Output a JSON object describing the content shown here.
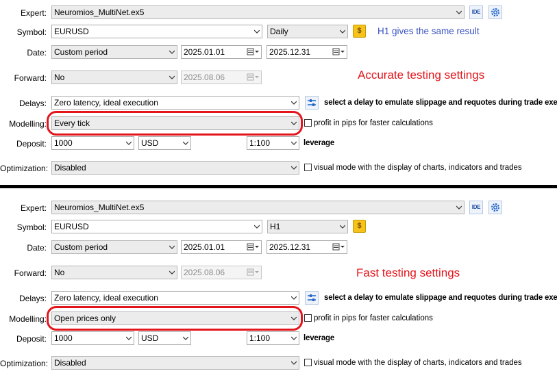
{
  "colors": {
    "accent_red": "#e3141b",
    "note_blue": "#3a52c4",
    "note_red": "#e3141b"
  },
  "labels": {
    "expert": "Expert:",
    "symbol": "Symbol:",
    "date": "Date:",
    "forward": "Forward:",
    "delays": "Delays:",
    "modelling": "Modelling:",
    "deposit": "Deposit:",
    "optimization": "Optimization:",
    "ide": "IDE",
    "coin": "$"
  },
  "hints": {
    "delay": "select a delay to emulate slippage and requotes during trade execution",
    "profit_pips": "profit in pips for faster calculations",
    "leverage": "leverage",
    "visual_mode": "visual mode with the display of charts, indicators and trades"
  },
  "top": {
    "expert": "Neuromios_MultiNet.ex5",
    "symbol": "EURUSD",
    "timeframe": "Daily",
    "date_mode": "Custom period",
    "date_from": "2025.01.01",
    "date_to": "2025.12.31",
    "forward": "No",
    "forward_date": "2025.08.06",
    "delays": "Zero latency, ideal execution",
    "modelling": "Every tick",
    "deposit": "1000",
    "currency": "USD",
    "leverage_value": "1:100",
    "optimization": "Disabled",
    "profit_pips_checked": false,
    "visual_mode_checked": false,
    "note_timeframe": "H1 gives the same result",
    "note_settings": "Accurate testing settings"
  },
  "bottom": {
    "expert": "Neuromios_MultiNet.ex5",
    "symbol": "EURUSD",
    "timeframe": "H1",
    "date_mode": "Custom period",
    "date_from": "2025.01.01",
    "date_to": "2025.12.31",
    "forward": "No",
    "forward_date": "2025.08.06",
    "delays": "Zero latency, ideal execution",
    "modelling": "Open prices only",
    "deposit": "1000",
    "currency": "USD",
    "leverage_value": "1:100",
    "optimization": "Disabled",
    "profit_pips_checked": false,
    "visual_mode_checked": false,
    "note_settings": "Fast testing settings"
  }
}
